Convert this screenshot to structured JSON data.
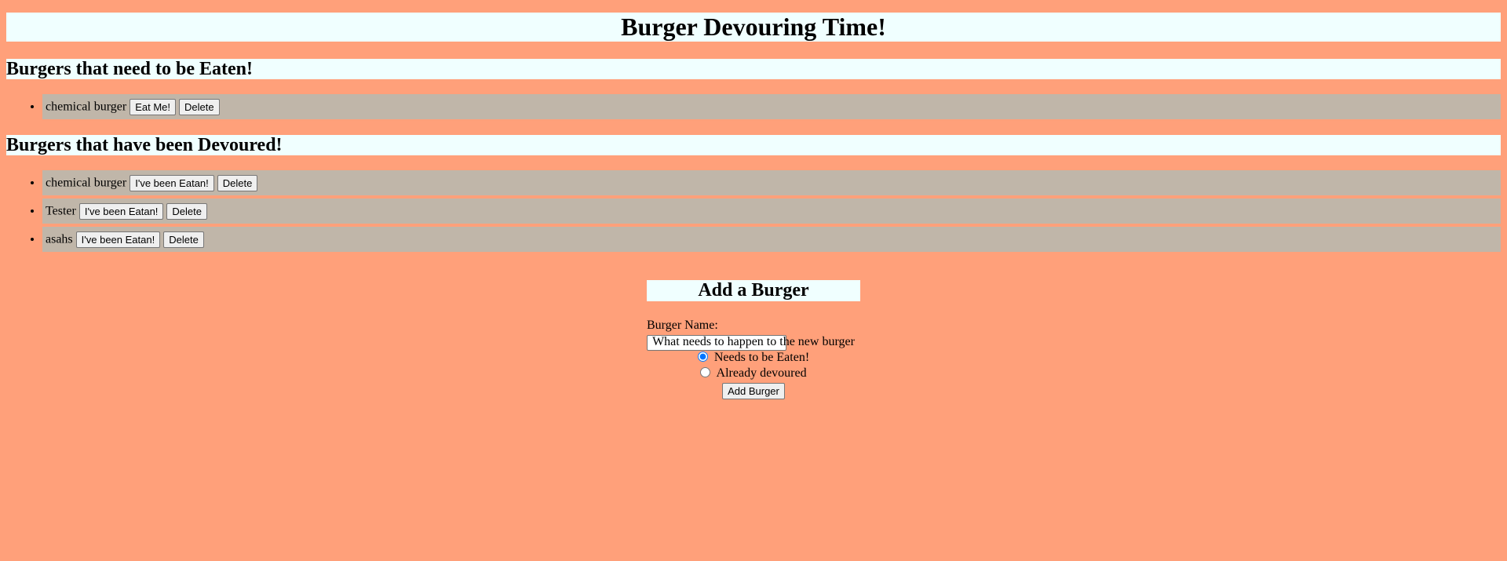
{
  "header": {
    "title": "Burger Devouring Time!"
  },
  "uneaten": {
    "title": "Burgers that need to be Eaten!",
    "items": [
      {
        "name": "chemical burger",
        "action_label": "Eat Me!",
        "delete_label": "Delete"
      }
    ]
  },
  "devoured": {
    "title": "Burgers that have been Devoured!",
    "items": [
      {
        "name": "chemical burger",
        "action_label": "I've been Eatan!",
        "delete_label": "Delete"
      },
      {
        "name": "Tester",
        "action_label": "I've been Eatan!",
        "delete_label": "Delete"
      },
      {
        "name": "asahs",
        "action_label": "I've been Eatan!",
        "delete_label": "Delete"
      }
    ]
  },
  "form": {
    "title": "Add a Burger",
    "name_label": "Burger Name:",
    "name_value": "",
    "question": "What needs to happen to the new burger",
    "options": [
      {
        "label": "Needs to be Eaten!",
        "checked": true
      },
      {
        "label": "Already devoured",
        "checked": false
      }
    ],
    "submit_label": "Add Burger"
  },
  "colors": {
    "background": "#FFA07A",
    "heading_bg": "#F0FFFF",
    "item_bg": "#C0B6A9"
  }
}
